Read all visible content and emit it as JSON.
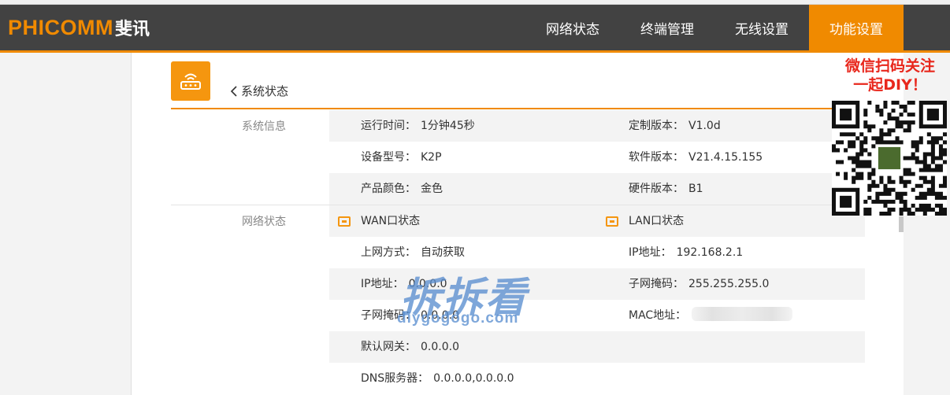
{
  "brand": {
    "name_en": "PHICOMM",
    "name_cn": "斐讯",
    "accent": "#f08a00"
  },
  "nav": [
    {
      "label": "网络状态",
      "active": false
    },
    {
      "label": "终端管理",
      "active": false
    },
    {
      "label": "无线设置",
      "active": false
    },
    {
      "label": "功能设置",
      "active": true
    }
  ],
  "page": {
    "badge_icon": "router-icon",
    "back_label": "系统状态"
  },
  "system_info": {
    "section_label": "系统信息",
    "rows": [
      {
        "left": {
          "label": "运行时间：",
          "value": "1分钟45秒"
        },
        "right": {
          "label": "定制版本：",
          "value": "V1.0d"
        }
      },
      {
        "left": {
          "label": "设备型号：",
          "value": "K2P"
        },
        "right": {
          "label": "软件版本：",
          "value": "V21.4.15.155"
        }
      },
      {
        "left": {
          "label": "产品颜色：",
          "value": "金色"
        },
        "right": {
          "label": "硬件版本：",
          "value": "B1"
        }
      }
    ]
  },
  "network_status": {
    "section_label": "网络状态",
    "wan_title": "WAN口状态",
    "lan_title": "LAN口状态",
    "wan": [
      {
        "label": "上网方式：",
        "value": "自动获取"
      },
      {
        "label": "IP地址：",
        "value": "0.0.0.0"
      },
      {
        "label": "子网掩码：",
        "value": "0.0.0.0"
      },
      {
        "label": "默认网关：",
        "value": "0.0.0.0"
      },
      {
        "label": "DNS服务器：",
        "value": "0.0.0.0,0.0.0.0"
      }
    ],
    "lan": [
      {
        "label": "IP地址：",
        "value": "192.168.2.1"
      },
      {
        "label": "子网掩码：",
        "value": "255.255.255.0"
      },
      {
        "label": "MAC地址：",
        "value": ""
      }
    ]
  },
  "promo": {
    "line1": "微信扫码关注",
    "line2": "一起DIY！",
    "qr_icon": "qr-code-icon"
  },
  "watermark": {
    "cn": "拆拆看",
    "en": "diygogogo.com"
  }
}
